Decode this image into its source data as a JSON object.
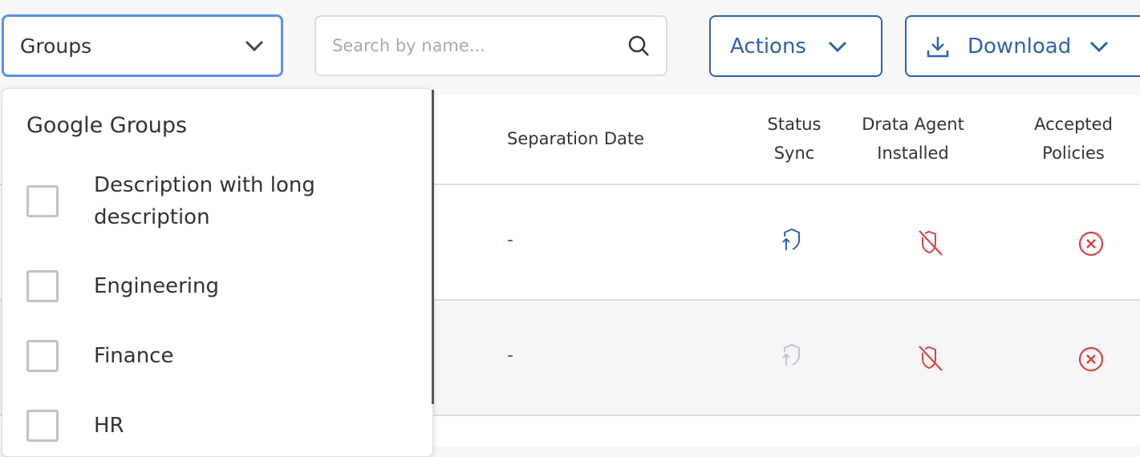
{
  "toolbar": {
    "groups_label": "Groups",
    "search_placeholder": "Search by name...",
    "actions_label": "Actions",
    "download_label": "Download"
  },
  "table": {
    "headers": {
      "separation_date": "Separation Date",
      "status_sync_1": "Status",
      "status_sync_2": "Sync",
      "agent_1": "Drata Agent",
      "agent_2": "Installed",
      "policies_1": "Accepted",
      "policies_2": "Policies"
    },
    "rows": [
      {
        "separation_date": "-",
        "status_sync": "synced",
        "agent_installed": false,
        "accepted_policies": false
      },
      {
        "separation_date": "-",
        "status_sync": "not-synced",
        "agent_installed": false,
        "accepted_policies": false
      }
    ]
  },
  "dropdown": {
    "title": "Google Groups",
    "options": [
      {
        "label": "Description with long description",
        "checked": false
      },
      {
        "label": "Engineering",
        "checked": false
      },
      {
        "label": "Finance",
        "checked": false
      },
      {
        "label": "HR",
        "checked": false
      }
    ]
  },
  "colors": {
    "accent": "#2f63a8",
    "focus": "#5b8ff0",
    "danger": "#d64545",
    "muted": "#bcc6d4"
  }
}
